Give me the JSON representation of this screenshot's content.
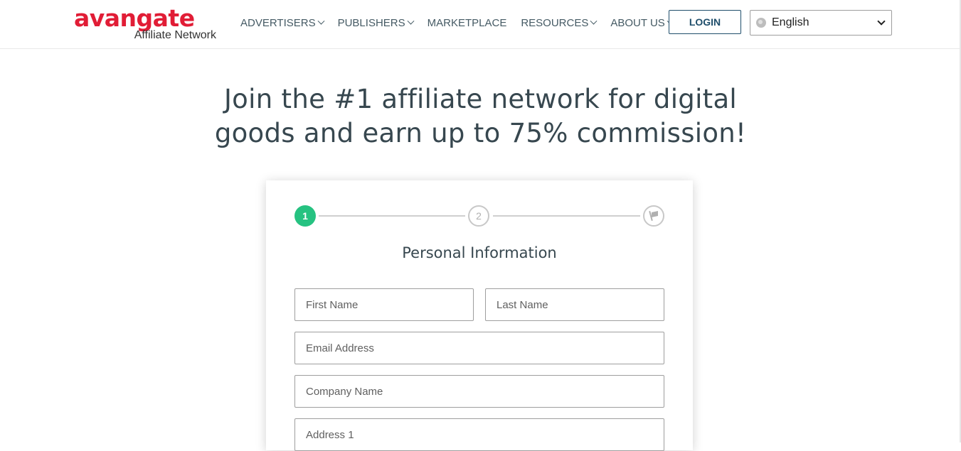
{
  "brand": {
    "logo_text": "avangate",
    "logo_sub": "Affiliate Network",
    "accent_color": "#e11d36"
  },
  "nav": {
    "items": [
      {
        "label": "ADVERTISERS",
        "has_dropdown": true
      },
      {
        "label": "PUBLISHERS",
        "has_dropdown": true
      },
      {
        "label": "MARKETPLACE",
        "has_dropdown": false
      },
      {
        "label": "RESOURCES",
        "has_dropdown": true
      },
      {
        "label": "ABOUT US",
        "has_dropdown": true
      }
    ],
    "login_label": "LOGIN",
    "language": {
      "selected": "English",
      "icon": "globe-icon"
    }
  },
  "hero": {
    "line1": "Join the #1 affiliate network for digital",
    "line2": "goods and earn up to 75% commission!"
  },
  "form": {
    "steps": [
      {
        "label": "1",
        "state": "active",
        "color": "#26c281"
      },
      {
        "label": "2",
        "state": "pending"
      },
      {
        "label": "",
        "icon": "flag-icon",
        "state": "pending"
      }
    ],
    "section_title": "Personal Information",
    "fields": {
      "first_name": {
        "placeholder": "First Name",
        "value": ""
      },
      "last_name": {
        "placeholder": "Last Name",
        "value": ""
      },
      "email": {
        "placeholder": "Email Address",
        "value": ""
      },
      "company": {
        "placeholder": "Company Name",
        "value": ""
      },
      "address1": {
        "placeholder": "Address 1",
        "value": ""
      }
    }
  }
}
